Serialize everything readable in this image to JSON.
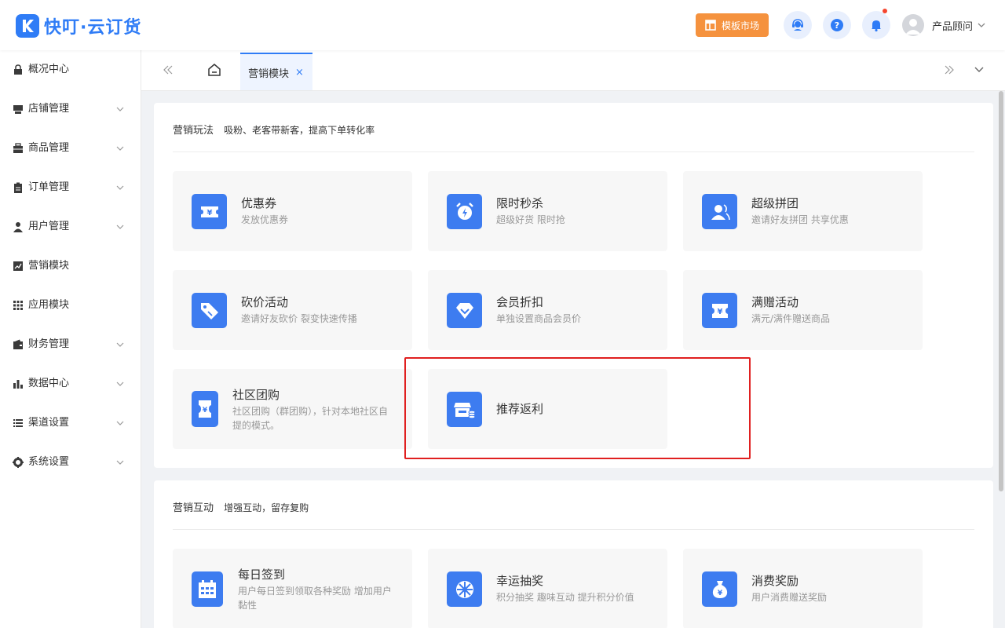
{
  "header": {
    "brand": "快叮·云订货",
    "template_button": "模板市场",
    "user_name": "产品顾问"
  },
  "sidebar": {
    "items": [
      {
        "label": "概况中心",
        "icon": "lock-bag-icon",
        "expandable": false
      },
      {
        "label": "店铺管理",
        "icon": "store-icon",
        "expandable": true
      },
      {
        "label": "商品管理",
        "icon": "box-icon",
        "expandable": true
      },
      {
        "label": "订单管理",
        "icon": "clipboard-icon",
        "expandable": true
      },
      {
        "label": "用户管理",
        "icon": "user-icon",
        "expandable": true
      },
      {
        "label": "营销模块",
        "icon": "trend-chart-icon",
        "expandable": false
      },
      {
        "label": "应用模块",
        "icon": "grid-icon",
        "expandable": false
      },
      {
        "label": "财务管理",
        "icon": "wallet-icon",
        "expandable": true
      },
      {
        "label": "数据中心",
        "icon": "bar-chart-icon",
        "expandable": true
      },
      {
        "label": "渠道设置",
        "icon": "list-icon",
        "expandable": true
      },
      {
        "label": "系统设置",
        "icon": "gear-icon",
        "expandable": true
      }
    ]
  },
  "tabs": {
    "active_label": "营销模块"
  },
  "sections": [
    {
      "title": "营销玩法",
      "desc": "吸粉、老客带新客，提高下单转化率",
      "cards": [
        {
          "title": "优惠券",
          "desc": "发放优惠券",
          "icon": "coupon-icon"
        },
        {
          "title": "限时秒杀",
          "desc": "超级好货 限时抢",
          "icon": "alarm-clock-icon"
        },
        {
          "title": "超级拼团",
          "desc": "邀请好友拼团 共享优惠",
          "icon": "group-user-icon"
        },
        {
          "title": "砍价活动",
          "desc": "邀请好友砍价 裂变快速传播",
          "icon": "price-tag-icon"
        },
        {
          "title": "会员折扣",
          "desc": "单独设置商品会员价",
          "icon": "diamond-icon"
        },
        {
          "title": "满赠活动",
          "desc": "满元/满件赠送商品",
          "icon": "gift-coupon-icon"
        },
        {
          "title": "社区团购",
          "desc": "社区团购（群团购），针对本地社区自提的模式。",
          "icon": "community-coupon-icon"
        },
        {
          "title": "推荐返利",
          "desc": "",
          "icon": "shop-coins-icon"
        }
      ]
    },
    {
      "title": "营销互动",
      "desc": "增强互动，留存复购",
      "cards": [
        {
          "title": "每日签到",
          "desc": "用户每日签到领取各种奖励 增加用户黏性",
          "icon": "calendar-icon"
        },
        {
          "title": "幸运抽奖",
          "desc": "积分抽奖 趣味互动 提升积分价值",
          "icon": "lucky-wheel-icon"
        },
        {
          "title": "消费奖励",
          "desc": "用户消费赠送奖励",
          "icon": "money-bag-icon"
        }
      ]
    }
  ],
  "colors": {
    "primary": "#2f7cf6",
    "card_icon": "#3d7cf0",
    "template_button": "#f5923e",
    "highlight": "#e02020"
  }
}
